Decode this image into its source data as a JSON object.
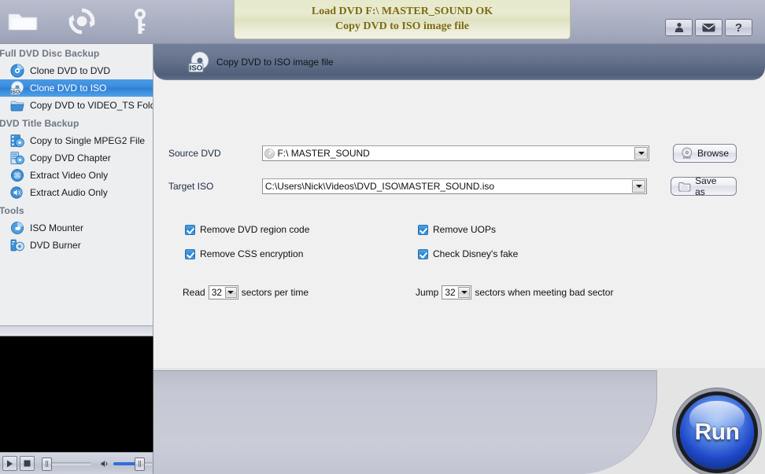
{
  "toolbar": {
    "icons": [
      {
        "name": "folder-icon",
        "label": "Open Folder"
      },
      {
        "name": "refresh-icon",
        "label": "Refresh Disc"
      },
      {
        "name": "key-icon",
        "label": "Register Key"
      }
    ],
    "right_buttons": [
      {
        "name": "user-icon",
        "label": ""
      },
      {
        "name": "mail-icon",
        "label": ""
      },
      {
        "name": "help-icon",
        "label": "?"
      }
    ]
  },
  "status_banner": {
    "line1": "Load DVD F:\\ MASTER_SOUND OK",
    "line2": "Copy DVD to ISO image file",
    "text_color": "#7d6a12",
    "bg_color": "#e9ebd0"
  },
  "sidebar": {
    "groups": [
      {
        "title": "Full DVD Disc Backup",
        "items": [
          {
            "label": "Clone DVD to DVD",
            "icon": "dvd-disc-icon",
            "selected": false
          },
          {
            "label": "Clone DVD to ISO",
            "icon": "iso-disc-icon",
            "selected": true
          },
          {
            "label": "Copy DVD to VIDEO_TS Folder",
            "icon": "folder-blue-icon",
            "selected": false
          }
        ]
      },
      {
        "title": "DVD Title Backup",
        "items": [
          {
            "label": "Copy to Single MPEG2 File",
            "icon": "film-icon",
            "selected": false
          },
          {
            "label": "Copy DVD Chapter",
            "icon": "chapter-icon",
            "selected": false
          },
          {
            "label": "Extract Video Only",
            "icon": "video-icon",
            "selected": false
          },
          {
            "label": "Extract Audio Only",
            "icon": "audio-icon",
            "selected": false
          }
        ]
      },
      {
        "title": "Tools",
        "items": [
          {
            "label": "ISO Mounter",
            "icon": "mount-icon",
            "selected": false
          },
          {
            "label": "DVD Burner",
            "icon": "burner-icon",
            "selected": false
          }
        ]
      }
    ],
    "selected_bg": "#3a8cdd"
  },
  "panel": {
    "header_title": "Copy DVD to ISO image file",
    "header_icon": "iso-disc-icon",
    "fields": [
      {
        "label": "Source DVD",
        "value": "F:\\ MASTER_SOUND",
        "has_disc_icon": true,
        "button": {
          "label": "Browse",
          "icon": "dvd-disc-icon"
        }
      },
      {
        "label": "Target ISO",
        "value": "C:\\Users\\Nick\\Videos\\DVD_ISO\\MASTER_SOUND.iso",
        "has_disc_icon": false,
        "button": {
          "label": "Save as",
          "icon": "folder-icon"
        }
      }
    ],
    "checkboxes": [
      {
        "label": "Remove DVD region code",
        "checked": true
      },
      {
        "label": "Remove UOPs",
        "checked": true
      },
      {
        "label": "Remove CSS encryption",
        "checked": true
      },
      {
        "label": "Check Disney's fake",
        "checked": true
      }
    ],
    "sector_options": [
      {
        "prefix": "Read",
        "value": "32",
        "suffix": "sectors per time"
      },
      {
        "prefix": "Jump",
        "value": "32",
        "suffix": "sectors when meeting bad sector"
      }
    ]
  },
  "player": {
    "play_label": "play-button",
    "stop_label": "stop-button",
    "seek_position_pct": 3,
    "volume_position_pct": 62
  },
  "run": {
    "label": "Run",
    "color": "#1f48c9"
  }
}
